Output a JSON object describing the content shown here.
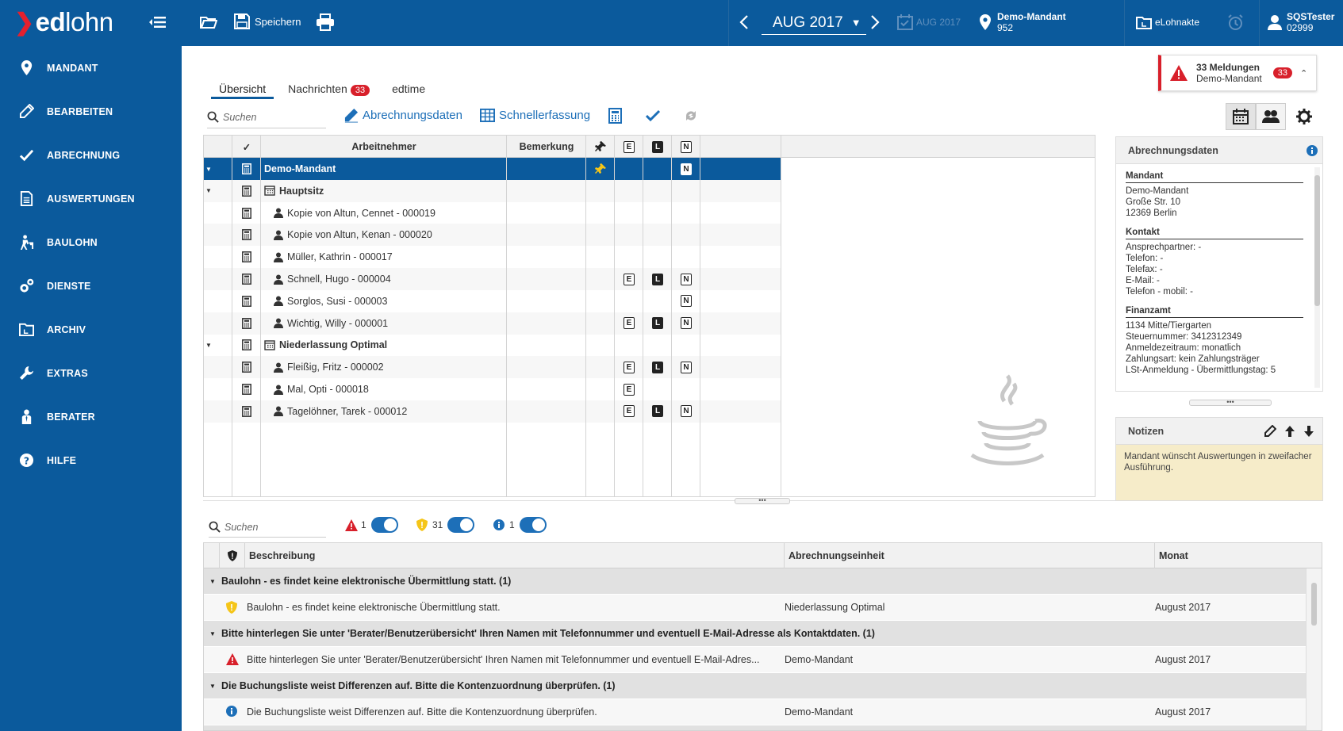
{
  "app": {
    "logo_prefix": "ed",
    "logo_suffix": "lohn"
  },
  "topbar": {
    "save_label": "Speichern",
    "month": "AUG 2017",
    "month_disabled": "AUG 2017",
    "mandant_name": "Demo-Mandant",
    "mandant_number": "952",
    "elohnakte_label": "eLohnakte",
    "user_name": "SQSTester",
    "user_number": "02999"
  },
  "sidebar": {
    "items": [
      {
        "label": "MANDANT",
        "icon": "location-pin-icon"
      },
      {
        "label": "BEARBEITEN",
        "icon": "pencil-icon"
      },
      {
        "label": "ABRECHNUNG",
        "icon": "check-icon"
      },
      {
        "label": "AUSWERTUNGEN",
        "icon": "document-icon"
      },
      {
        "label": "BAULOHN",
        "icon": "worker-icon"
      },
      {
        "label": "DIENSTE",
        "icon": "gears-icon"
      },
      {
        "label": "ARCHIV",
        "icon": "archive-folder-icon"
      },
      {
        "label": "EXTRAS",
        "icon": "wrench-icon"
      },
      {
        "label": "BERATER",
        "icon": "advisor-icon"
      },
      {
        "label": "HILFE",
        "icon": "help-icon"
      }
    ]
  },
  "tabs": [
    {
      "label": "Übersicht",
      "active": true
    },
    {
      "label": "Nachrichten",
      "badge": "33"
    },
    {
      "label": "edtime"
    }
  ],
  "alert": {
    "title": "33 Meldungen",
    "subtitle": "Demo-Mandant",
    "badge": "33"
  },
  "toolbar": {
    "search_placeholder": "Suchen",
    "abrechnungsdaten_label": "Abrechnungsdaten",
    "schnellerfassung_label": "Schnellerfassung"
  },
  "grid": {
    "headers": {
      "check": "✓",
      "arbeitnehmer": "Arbeitnehmer",
      "bemerkung": "Bemerkung",
      "e": "E",
      "l": "L",
      "n": "N"
    },
    "rows": [
      {
        "label": "Demo-Mandant",
        "type": "mandant",
        "pin": true,
        "n": true
      },
      {
        "label": "Hauptsitz",
        "type": "branch"
      },
      {
        "label": "Kopie von Altun, Cennet - 000019",
        "type": "employee"
      },
      {
        "label": "Kopie von Altun, Kenan - 000020",
        "type": "employee"
      },
      {
        "label": "Müller, Kathrin - 000017",
        "type": "employee"
      },
      {
        "label": "Schnell, Hugo - 000004",
        "type": "employee",
        "e": true,
        "l": true,
        "n": true
      },
      {
        "label": "Sorglos, Susi - 000003",
        "type": "employee",
        "n": true
      },
      {
        "label": "Wichtig, Willy - 000001",
        "type": "employee",
        "e": true,
        "l": true,
        "n": true
      },
      {
        "label": "Niederlassung Optimal",
        "type": "branch"
      },
      {
        "label": "Fleißig, Fritz - 000002",
        "type": "employee",
        "e": true,
        "l": true,
        "n": true
      },
      {
        "label": "Mal, Opti - 000018",
        "type": "employee",
        "e": true
      },
      {
        "label": "Tagelöhner, Tarek - 000012",
        "type": "employee",
        "e": true,
        "l": true,
        "n": true
      }
    ]
  },
  "details": {
    "title": "Abrechnungsdaten",
    "mandant_heading": "Mandant",
    "mandant_lines": [
      "Demo-Mandant",
      "Große Str. 10",
      "12369 Berlin"
    ],
    "kontakt_heading": "Kontakt",
    "kontakt_lines": [
      "Ansprechpartner: -",
      "Telefon: -",
      "Telefax: -",
      "E-Mail: -",
      "Telefon - mobil: -"
    ],
    "finanzamt_heading": "Finanzamt",
    "finanzamt_lines": [
      "1134 Mitte/Tiergarten",
      "Steuernummer: 3412312349",
      "Anmeldezeitraum: monatlich",
      "Zahlungsart: kein Zahlungsträger",
      "LSt-Anmeldung - Übermittlungstag: 5"
    ]
  },
  "notes": {
    "title": "Notizen",
    "text": "Mandant wünscht Auswertungen in zweifacher Ausführung."
  },
  "messages": {
    "search_placeholder": "Suchen",
    "filter_error_count": "1",
    "filter_warning_count": "31",
    "filter_info_count": "1",
    "headers": {
      "beschreibung": "Beschreibung",
      "einheit": "Abrechnungseinheit",
      "monat": "Monat"
    },
    "groups": [
      {
        "title": "Baulohn - es findet keine elektronische Übermittlung statt. (1)",
        "item": "Baulohn - es findet keine elektronische Übermittlung statt.",
        "einheit": "Niederlassung Optimal",
        "monat": "August 2017",
        "severity": "warning"
      },
      {
        "title": "Bitte hinterlegen Sie unter 'Berater/Benutzerübersicht' Ihren Namen mit Telefonnummer und eventuell E-Mail-Adresse als Kontaktdaten. (1)",
        "item": "Bitte hinterlegen Sie unter 'Berater/Benutzerübersicht' Ihren Namen mit Telefonnummer und eventuell E-Mail-Adres...",
        "einheit": "Demo-Mandant",
        "monat": "August 2017",
        "severity": "error"
      },
      {
        "title": "Die Buchungsliste weist Differenzen auf. Bitte die Kontenzuordnung überprüfen. (1)",
        "item": "Die Buchungsliste weist Differenzen auf. Bitte die Kontenzuordnung überprüfen.",
        "einheit": "Demo-Mandant",
        "monat": "August 2017",
        "severity": "info"
      }
    ]
  }
}
